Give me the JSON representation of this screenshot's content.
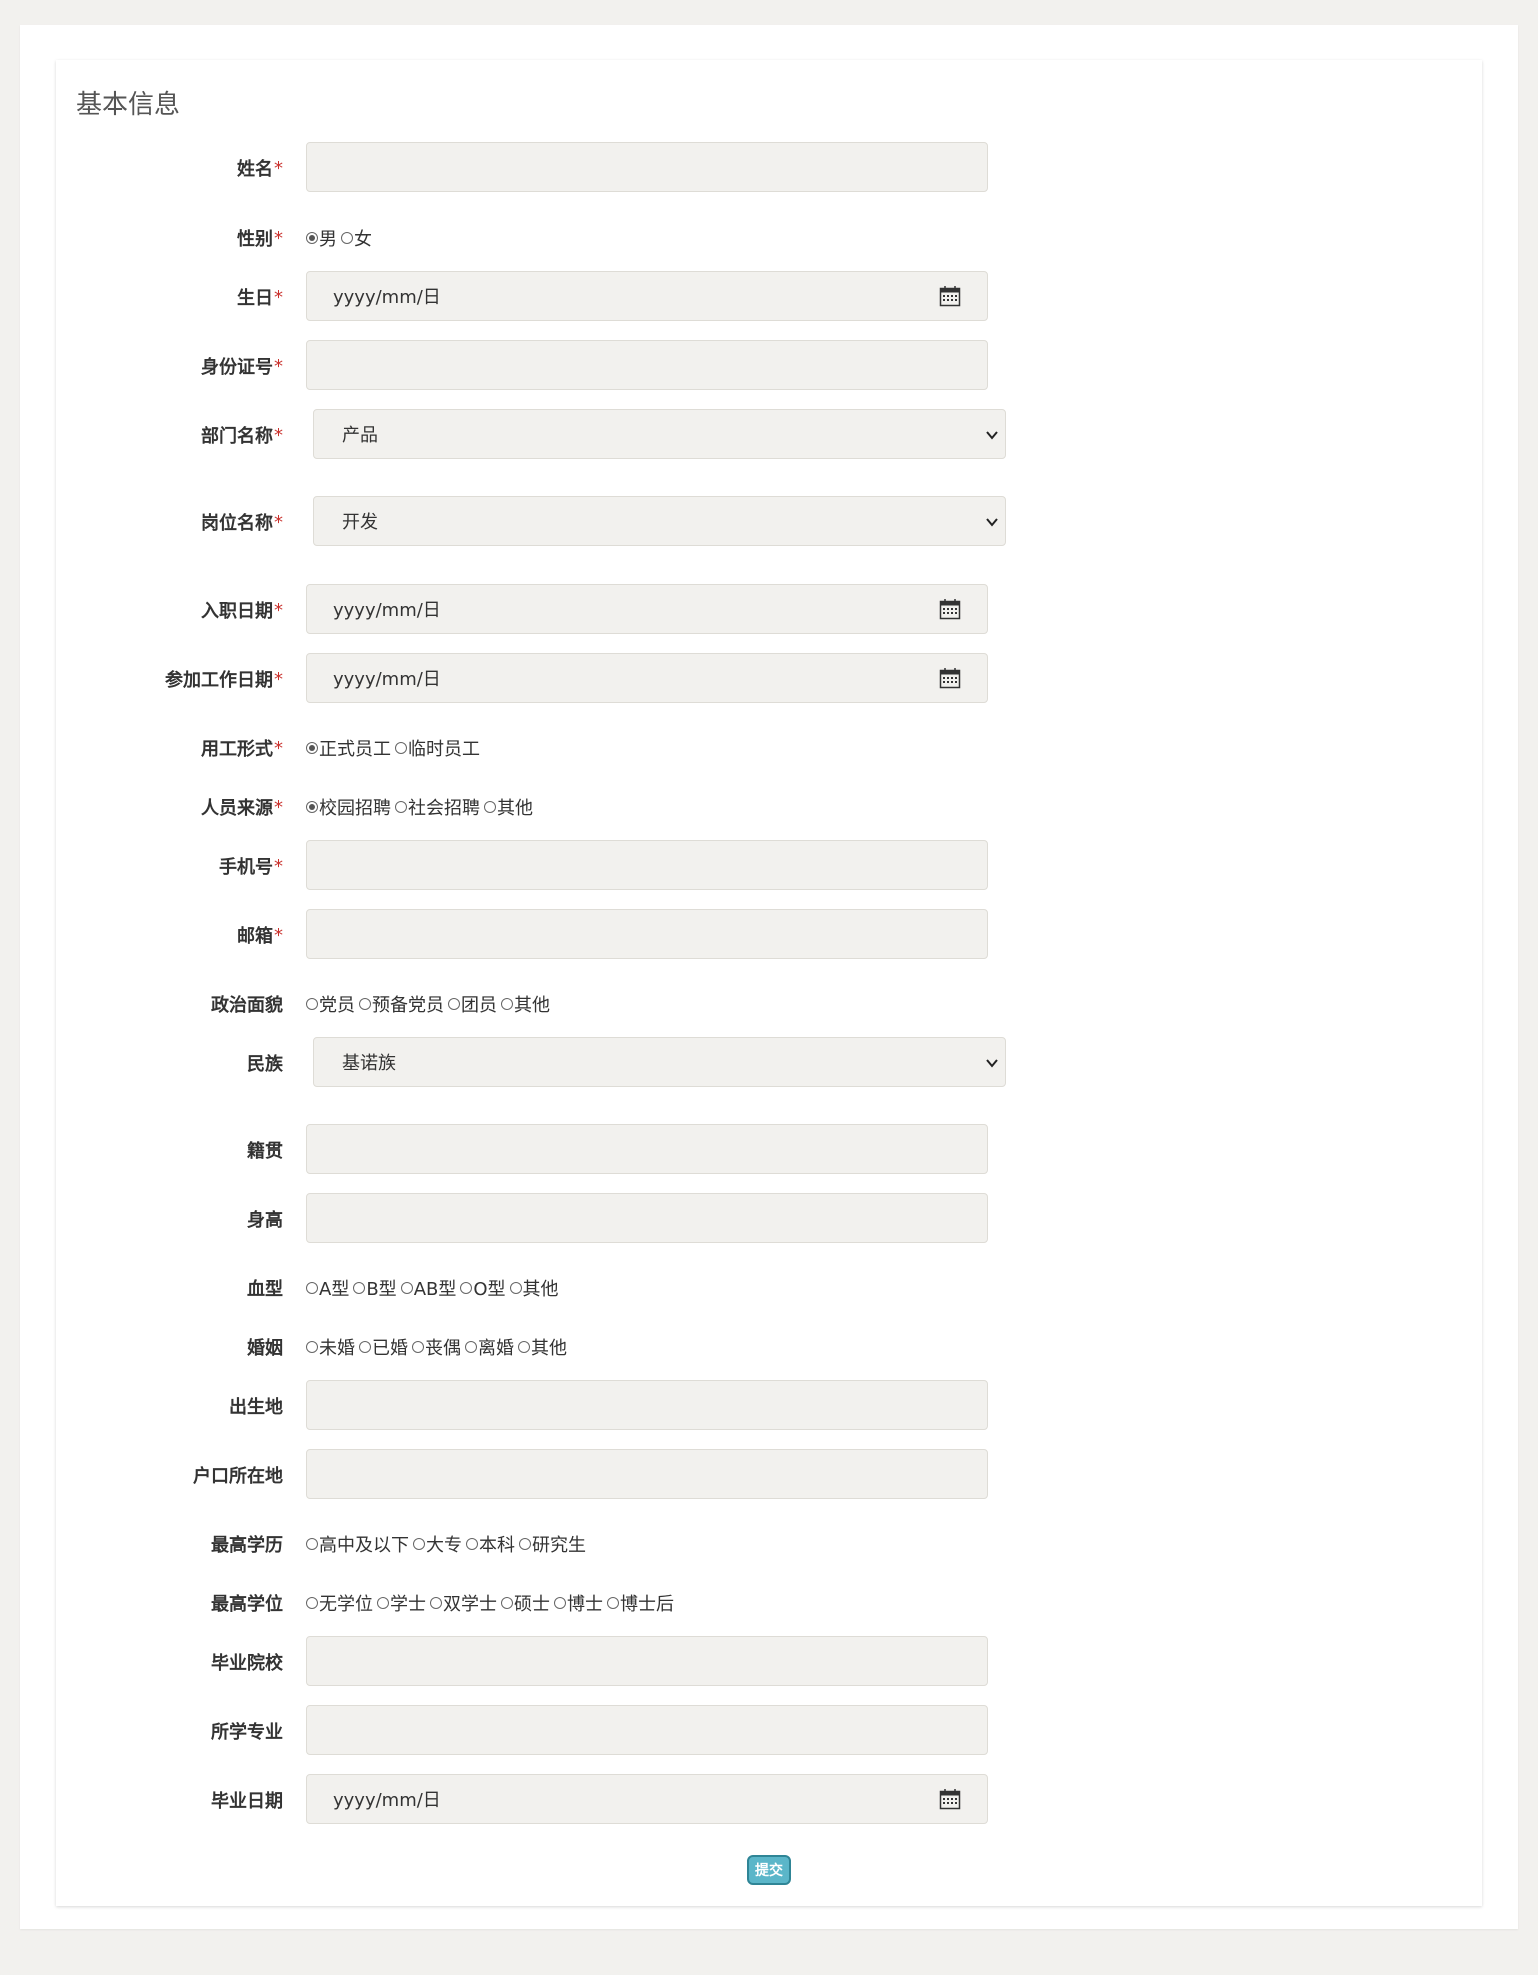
{
  "section_title": "基本信息",
  "required_mark": "*",
  "date_placeholder": "yyyy/mm/日",
  "fields": {
    "name": {
      "label": "姓名"
    },
    "gender": {
      "label": "性别",
      "options": [
        "男",
        "女"
      ],
      "selected": "男"
    },
    "birthday": {
      "label": "生日"
    },
    "id_number": {
      "label": "身份证号"
    },
    "department": {
      "label": "部门名称",
      "selected": "产品"
    },
    "position": {
      "label": "岗位名称",
      "selected": "开发"
    },
    "hire_date": {
      "label": "入职日期"
    },
    "work_start_date": {
      "label": "参加工作日期"
    },
    "employment_type": {
      "label": "用工形式",
      "options": [
        "正式员工",
        "临时员工"
      ],
      "selected": "正式员工"
    },
    "source": {
      "label": "人员来源",
      "options": [
        "校园招聘",
        "社会招聘",
        "其他"
      ],
      "selected": "校园招聘"
    },
    "phone": {
      "label": "手机号"
    },
    "email": {
      "label": "邮箱"
    },
    "political_status": {
      "label": "政治面貌",
      "options": [
        "党员",
        "预备党员",
        "团员",
        "其他"
      ]
    },
    "ethnicity": {
      "label": "民族",
      "selected": "基诺族"
    },
    "native_place": {
      "label": "籍贯"
    },
    "height": {
      "label": "身高"
    },
    "blood_type": {
      "label": "血型",
      "options": [
        "A型",
        "B型",
        "AB型",
        "O型",
        "其他"
      ]
    },
    "marriage": {
      "label": "婚姻",
      "options": [
        "未婚",
        "已婚",
        "丧偶",
        "离婚",
        "其他"
      ]
    },
    "birthplace": {
      "label": "出生地"
    },
    "household_location": {
      "label": "户口所在地"
    },
    "education": {
      "label": "最高学历",
      "options": [
        "高中及以下",
        "大专",
        "本科",
        "研究生"
      ]
    },
    "degree": {
      "label": "最高学位",
      "options": [
        "无学位",
        "学士",
        "双学士",
        "硕士",
        "博士",
        "博士后"
      ]
    },
    "school": {
      "label": "毕业院校"
    },
    "major": {
      "label": "所学专业"
    },
    "graduation_date": {
      "label": "毕业日期"
    }
  },
  "submit_label": "提交"
}
